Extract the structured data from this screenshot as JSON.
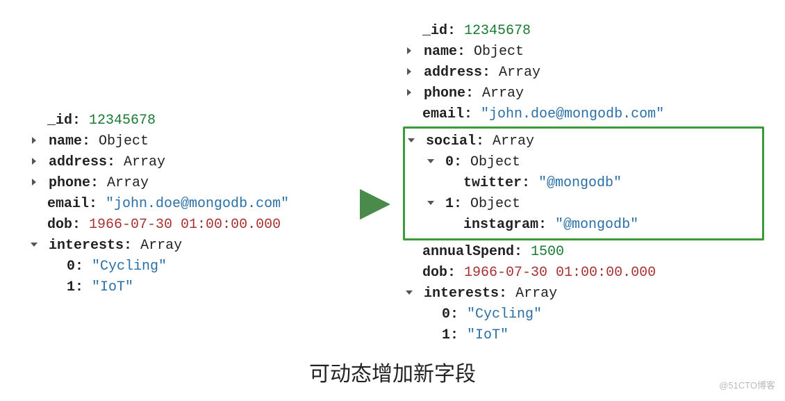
{
  "left": {
    "id_key": "_id:",
    "id_val": "12345678",
    "name_key": "name:",
    "name_type": "Object",
    "address_key": "address:",
    "address_type": "Array",
    "phone_key": "phone:",
    "phone_type": "Array",
    "email_key": "email:",
    "email_val": "\"john.doe@mongodb.com\"",
    "dob_key": "dob:",
    "dob_val": "1966-07-30 01:00:00.000",
    "interests_key": "interests:",
    "interests_type": "Array",
    "interests": [
      {
        "idx": "0:",
        "val": "\"Cycling\""
      },
      {
        "idx": "1:",
        "val": "\"IoT\""
      }
    ]
  },
  "right": {
    "id_key": "_id:",
    "id_val": "12345678",
    "name_key": "name:",
    "name_type": "Object",
    "address_key": "address:",
    "address_type": "Array",
    "phone_key": "phone:",
    "phone_type": "Array",
    "email_key": "email:",
    "email_val": "\"john.doe@mongodb.com\"",
    "social_key": "social:",
    "social_type": "Array",
    "social": [
      {
        "idx": "0:",
        "type": "Object",
        "field_key": "twitter:",
        "field_val": "\"@mongodb\""
      },
      {
        "idx": "1:",
        "type": "Object",
        "field_key": "instagram:",
        "field_val": "\"@mongodb\""
      }
    ],
    "annualSpend_key": "annualSpend:",
    "annualSpend_val": "1500",
    "dob_key": "dob:",
    "dob_val": "1966-07-30 01:00:00.000",
    "interests_key": "interests:",
    "interests_type": "Array",
    "interests": [
      {
        "idx": "0:",
        "val": "\"Cycling\""
      },
      {
        "idx": "1:",
        "val": "\"IoT\""
      }
    ]
  },
  "caption": "可动态增加新字段",
  "watermark": "@51CTO博客"
}
